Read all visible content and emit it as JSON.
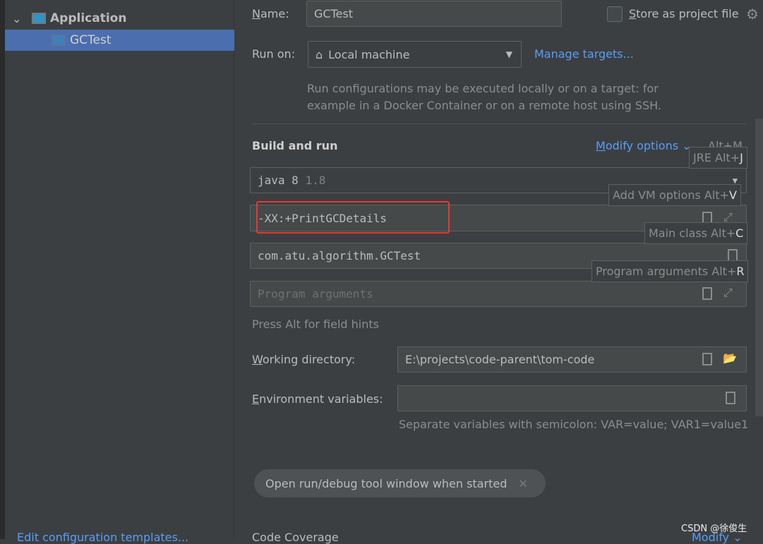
{
  "sidebar": {
    "group": "Application",
    "item": "GCTest",
    "footer_link": "Edit configuration templates..."
  },
  "form": {
    "name_label": "Name:",
    "name_value": "GCTest",
    "store_label": "Store as project file",
    "run_on_label": "Run on:",
    "run_on_value": "Local machine",
    "manage_targets": "Manage targets...",
    "run_on_hint_1": "Run configurations may be executed locally or on a target: for",
    "run_on_hint_2": "example in a Docker Container or on a remote host using SSH.",
    "build_run": "Build and run",
    "modify_options": "Modify options",
    "modify_shortcut": "Alt+M",
    "jre_value": "java 8",
    "jre_version": "1.8",
    "vm_options": "-XX:+PrintGCDetails",
    "main_class": "com.atu.algorithm.GCTest",
    "program_args_placeholder": "Program arguments",
    "field_hints": "Press Alt for field hints",
    "working_dir_label": "Working directory:",
    "working_dir_value": "E:\\projects\\code-parent\\tom-code",
    "env_label": "Environment variables:",
    "env_value": "",
    "env_hint": "Separate variables with semicolon: VAR=value; VAR1=value1",
    "chip": "Open run/debug tool window when started",
    "code_coverage": "Code Coverage",
    "modify": "Modify"
  },
  "tooltips": {
    "jre": {
      "text": "JRE Alt+",
      "key": "J"
    },
    "vm": {
      "text": "Add VM options Alt+",
      "key": "V"
    },
    "main": {
      "text": "Main class Alt+",
      "key": "C"
    },
    "args": {
      "text": "Program arguments Alt+",
      "key": "R"
    }
  },
  "watermark": "CSDN @徐俊生",
  "colors": {
    "highlight_box": "#e53935",
    "selection": "#4b6eaf",
    "link": "#589df6"
  }
}
